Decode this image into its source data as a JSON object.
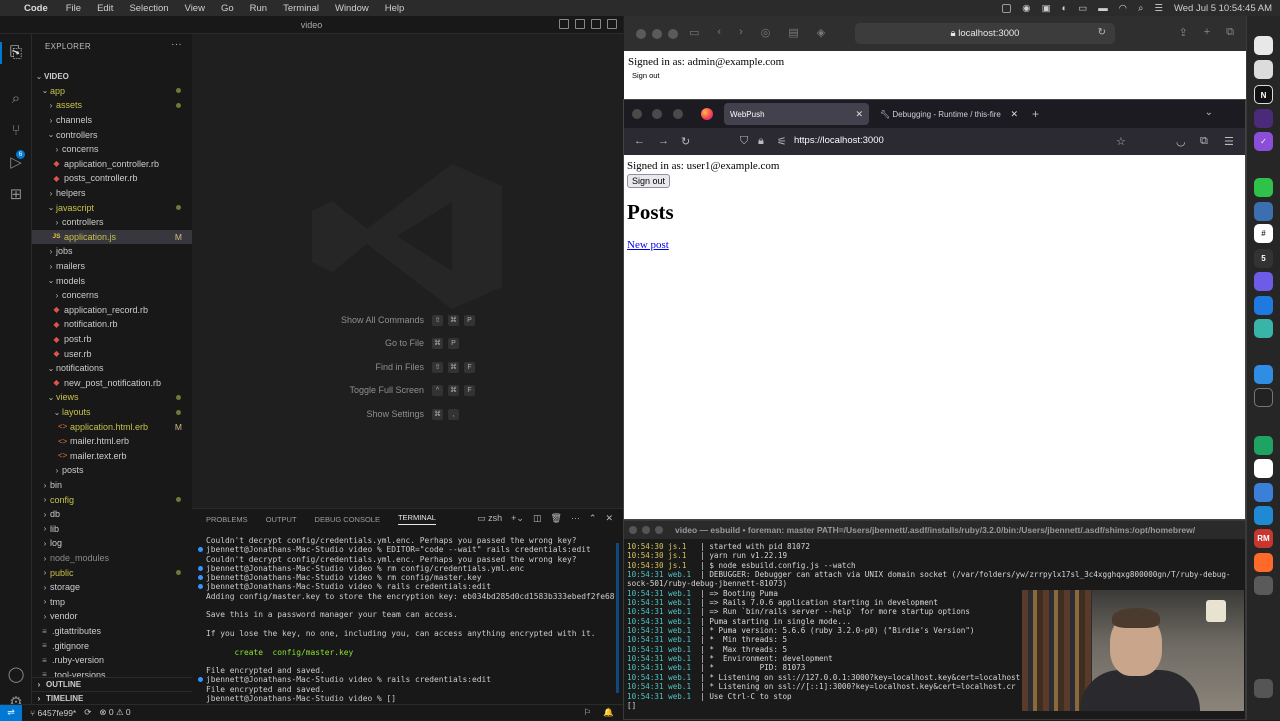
{
  "menubar": {
    "app": "Code",
    "items": [
      "File",
      "Edit",
      "Selection",
      "View",
      "Go",
      "Run",
      "Terminal",
      "Window",
      "Help"
    ],
    "clock": "Wed Jul 5  10:54:45 AM"
  },
  "vscode": {
    "window_title": "video",
    "explorer_label": "EXPLORER",
    "root": "VIDEO",
    "tree": [
      {
        "label": "app",
        "depth": 1,
        "kind": "folder-open",
        "color": "green",
        "dot": true
      },
      {
        "label": "assets",
        "depth": 2,
        "kind": "folder",
        "color": "green",
        "dot": true
      },
      {
        "label": "channels",
        "depth": 2,
        "kind": "folder"
      },
      {
        "label": "controllers",
        "depth": 2,
        "kind": "folder-open"
      },
      {
        "label": "concerns",
        "depth": 3,
        "kind": "folder"
      },
      {
        "label": "application_controller.rb",
        "depth": 3,
        "kind": "rb"
      },
      {
        "label": "posts_controller.rb",
        "depth": 3,
        "kind": "rb"
      },
      {
        "label": "helpers",
        "depth": 2,
        "kind": "folder"
      },
      {
        "label": "javascript",
        "depth": 2,
        "kind": "folder-open",
        "color": "green",
        "dot": true
      },
      {
        "label": "controllers",
        "depth": 3,
        "kind": "folder"
      },
      {
        "label": "application.js",
        "depth": 3,
        "kind": "js",
        "color": "green",
        "mark": "M",
        "selected": true
      },
      {
        "label": "jobs",
        "depth": 2,
        "kind": "folder"
      },
      {
        "label": "mailers",
        "depth": 2,
        "kind": "folder"
      },
      {
        "label": "models",
        "depth": 2,
        "kind": "folder-open"
      },
      {
        "label": "concerns",
        "depth": 3,
        "kind": "folder"
      },
      {
        "label": "application_record.rb",
        "depth": 3,
        "kind": "rb"
      },
      {
        "label": "notification.rb",
        "depth": 3,
        "kind": "rb"
      },
      {
        "label": "post.rb",
        "depth": 3,
        "kind": "rb"
      },
      {
        "label": "user.rb",
        "depth": 3,
        "kind": "rb"
      },
      {
        "label": "notifications",
        "depth": 2,
        "kind": "folder-open"
      },
      {
        "label": "new_post_notification.rb",
        "depth": 3,
        "kind": "rb"
      },
      {
        "label": "views",
        "depth": 2,
        "kind": "folder-open",
        "color": "green",
        "dot": true
      },
      {
        "label": "layouts",
        "depth": 3,
        "kind": "folder-open",
        "color": "green",
        "dot": true
      },
      {
        "label": "application.html.erb",
        "depth": 4,
        "kind": "erb",
        "color": "green",
        "mark": "M"
      },
      {
        "label": "mailer.html.erb",
        "depth": 4,
        "kind": "erb"
      },
      {
        "label": "mailer.text.erb",
        "depth": 4,
        "kind": "erb"
      },
      {
        "label": "posts",
        "depth": 3,
        "kind": "folder"
      },
      {
        "label": "bin",
        "depth": 1,
        "kind": "folder"
      },
      {
        "label": "config",
        "depth": 1,
        "kind": "folder",
        "color": "green",
        "dot": true
      },
      {
        "label": "db",
        "depth": 1,
        "kind": "folder"
      },
      {
        "label": "lib",
        "depth": 1,
        "kind": "folder"
      },
      {
        "label": "log",
        "depth": 1,
        "kind": "folder"
      },
      {
        "label": "node_modules",
        "depth": 1,
        "kind": "folder",
        "color": "gray"
      },
      {
        "label": "public",
        "depth": 1,
        "kind": "folder",
        "color": "green",
        "dot": true
      },
      {
        "label": "storage",
        "depth": 1,
        "kind": "folder"
      },
      {
        "label": "tmp",
        "depth": 1,
        "kind": "folder"
      },
      {
        "label": "vendor",
        "depth": 1,
        "kind": "folder"
      },
      {
        "label": ".gitattributes",
        "depth": 1,
        "kind": "file"
      },
      {
        "label": ".gitignore",
        "depth": 1,
        "kind": "file"
      },
      {
        "label": ".ruby-version",
        "depth": 1,
        "kind": "file"
      },
      {
        "label": ".tool-versions",
        "depth": 1,
        "kind": "file"
      }
    ],
    "outline_label": "OUTLINE",
    "timeline_label": "TIMELINE",
    "commands": [
      {
        "label": "Show All Commands",
        "keys": [
          "⇧",
          "⌘",
          "P"
        ]
      },
      {
        "label": "Go to File",
        "keys": [
          "⌘",
          "P"
        ]
      },
      {
        "label": "Find in Files",
        "keys": [
          "⇧",
          "⌘",
          "F"
        ]
      },
      {
        "label": "Toggle Full Screen",
        "keys": [
          "^",
          "⌘",
          "F"
        ]
      },
      {
        "label": "Show Settings",
        "keys": [
          "⌘",
          ","
        ]
      }
    ],
    "panel_tabs": [
      "PROBLEMS",
      "OUTPUT",
      "DEBUG CONSOLE",
      "TERMINAL"
    ],
    "shell": "zsh",
    "terminal_lines": [
      {
        "text": "Couldn't decrypt config/credentials.yml.enc. Perhaps you passed the wrong key?",
        "bullet": false
      },
      {
        "text": "jbennett@Jonathans-Mac-Studio video % EDITOR=\"code --wait\" rails credentials:edit",
        "bullet": true
      },
      {
        "text": "Couldn't decrypt config/credentials.yml.enc. Perhaps you passed the wrong key?",
        "bullet": false
      },
      {
        "text": "jbennett@Jonathans-Mac-Studio video % rm config/credentials.yml.enc",
        "bullet": true
      },
      {
        "text": "jbennett@Jonathans-Mac-Studio video % rm config/master.key",
        "bullet": true
      },
      {
        "text": "jbennett@Jonathans-Mac-Studio video % rails credentials:edit",
        "bullet": true
      },
      {
        "text": "Adding config/master.key to store the encryption key: eb034bd285d0cd1583b333ebedf2fe68",
        "bullet": false
      },
      {
        "text": "",
        "bullet": false
      },
      {
        "text": "Save this in a password manager your team can access.",
        "bullet": false
      },
      {
        "text": "",
        "bullet": false
      },
      {
        "text": "If you lose the key, no one, including you, can access anything encrypted with it.",
        "bullet": false
      },
      {
        "text": "",
        "bullet": false
      },
      {
        "text": "      create  config/master.key",
        "bullet": false
      },
      {
        "text": "",
        "bullet": false
      },
      {
        "text": "File encrypted and saved.",
        "bullet": false
      },
      {
        "text": "jbennett@Jonathans-Mac-Studio video % rails credentials:edit",
        "bullet": true
      },
      {
        "text": "File encrypted and saved.",
        "bullet": false
      },
      {
        "text": "jbennett@Jonathans-Mac-Studio video % []",
        "bullet": false
      }
    ],
    "status": {
      "branch": "6457fe99*",
      "sync": "⟳",
      "problems": "⊗ 0 ⚠ 0"
    }
  },
  "safari": {
    "url": "localhost:3000",
    "signed_in": "Signed in as: admin@example.com",
    "sign_out": "Sign out"
  },
  "firefox": {
    "tab_active": "WebPush",
    "tab_other": "Debugging - Runtime / this-fire",
    "url": "https://localhost:3000",
    "signed_in": "Signed in as: user1@example.com",
    "sign_out": "Sign out",
    "heading": "Posts",
    "new_post": "New post"
  },
  "foreman": {
    "title": "video — esbuild • foreman: master PATH=/Users/jbennett/.asdf/installs/ruby/3.2.0/bin:/Users/jbennett/.asdf/shims:/opt/homebrew/",
    "lines": [
      {
        "ts": "10:54:30",
        "proc": "js.1",
        "text": "| started with pid 81072"
      },
      {
        "ts": "10:54:30",
        "proc": "js.1",
        "text": "| yarn run v1.22.19"
      },
      {
        "ts": "10:54:30",
        "proc": "js.1",
        "text": "| $ node esbuild.config.js --watch"
      },
      {
        "ts": "10:54:31",
        "proc": "web.1",
        "text": "| DEBUGGER: Debugger can attach via UNIX domain socket (/var/folders/yw/zrrpylx17sl_3c4xgghqxg800000gn/T/ruby-debug-"
      },
      {
        "ts": "",
        "proc": "",
        "text": "sock-501/ruby-debug-jbennett-81073)"
      },
      {
        "ts": "10:54:31",
        "proc": "web.1",
        "text": "| => Booting Puma"
      },
      {
        "ts": "10:54:31",
        "proc": "web.1",
        "text": "| => Rails 7.0.6 application starting in development"
      },
      {
        "ts": "10:54:31",
        "proc": "web.1",
        "text": "| => Run `bin/rails server --help` for more startup options"
      },
      {
        "ts": "10:54:31",
        "proc": "web.1",
        "text": "| Puma starting in single mode..."
      },
      {
        "ts": "10:54:31",
        "proc": "web.1",
        "text": "| * Puma version: 5.6.6 (ruby 3.2.0-p0) (\"Birdie's Version\")"
      },
      {
        "ts": "10:54:31",
        "proc": "web.1",
        "text": "| *  Min threads: 5"
      },
      {
        "ts": "10:54:31",
        "proc": "web.1",
        "text": "| *  Max threads: 5"
      },
      {
        "ts": "10:54:31",
        "proc": "web.1",
        "text": "| *  Environment: development"
      },
      {
        "ts": "10:54:31",
        "proc": "web.1",
        "text": "| *          PID: 81073"
      },
      {
        "ts": "10:54:31",
        "proc": "web.1",
        "text": "| * Listening on ssl://127.0.0.1:3000?key=localhost.key&cert=localhost"
      },
      {
        "ts": "10:54:31",
        "proc": "web.1",
        "text": "| * Listening on ssl://[::1]:3000?key=localhost.key&cert=localhost.cr"
      },
      {
        "ts": "10:54:31",
        "proc": "web.1",
        "text": "| Use Ctrl-C to stop"
      },
      {
        "ts": "",
        "proc": "",
        "text": "[]"
      }
    ]
  }
}
